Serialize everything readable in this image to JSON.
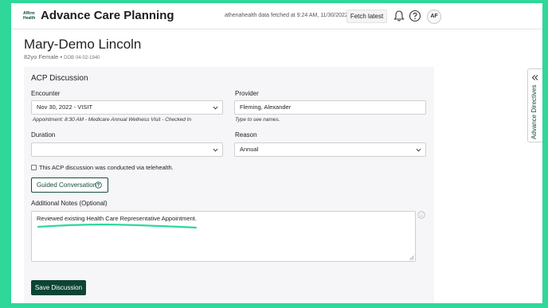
{
  "app": {
    "logo_line1": "Affirm",
    "logo_line2": "Health",
    "title": "Advance Care Planning",
    "fetch_info": "athenahealth data fetched at 9:24 AM, 11/30/2022.",
    "fetch_button": "Fetch latest",
    "user_initials": "AF"
  },
  "patient": {
    "name": "Mary-Demo Lincoln",
    "summary": "82yo Female • ",
    "dob": "DOB 04-02-1940"
  },
  "acp": {
    "title": "ACP Discussion",
    "encounter": {
      "label": "Encounter",
      "value": "Nov 30, 2022 - VISIT",
      "hint": "Appointment: 8:30 AM - Medicare Annual Wellness Visit - Checked In"
    },
    "provider": {
      "label": "Provider",
      "value": "Fleming, Alexander",
      "hint": "Type to see names."
    },
    "duration": {
      "label": "Duration",
      "value": ""
    },
    "reason": {
      "label": "Reason",
      "value": "Annual"
    },
    "telehealth_label": "This ACP discussion was conducted via telehealth.",
    "telehealth_checked": false,
    "guided_button": "Guided Conversation",
    "notes": {
      "label": "Additional Notes (Optional)",
      "value": "Reviewed existing Health Care Representative Appointment."
    },
    "save_button": "Save Discussion"
  },
  "side_tab": {
    "label": "Advance Directives"
  },
  "colors": {
    "frame": "#2fd79a",
    "primary": "#0d4434",
    "highlight": "#2fd79a"
  }
}
